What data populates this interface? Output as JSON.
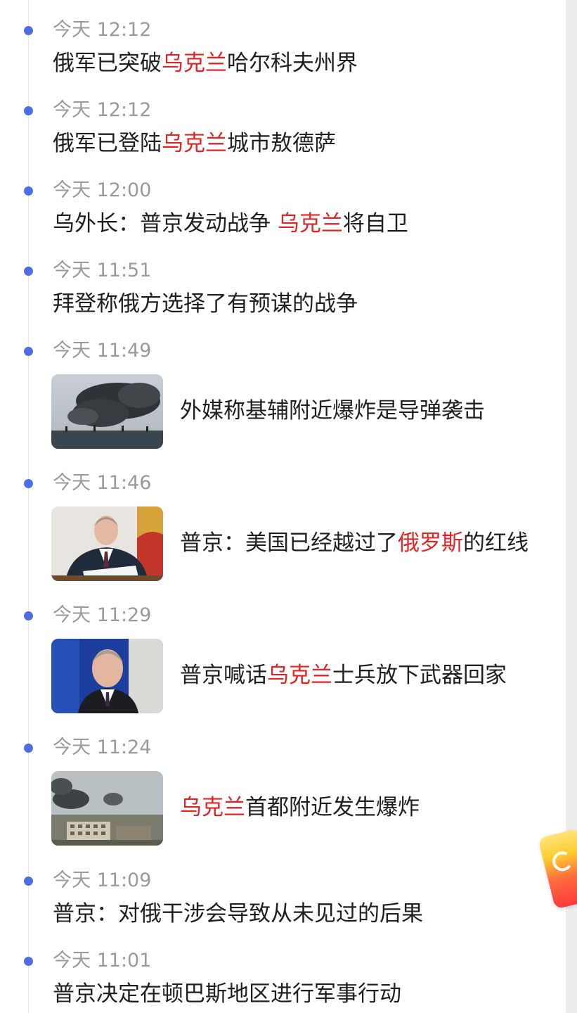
{
  "colors": {
    "accent_dot": "#4f6ee0",
    "highlight": "#e22424",
    "time": "#9a9a9a",
    "text": "#1f1f1f"
  },
  "feed": [
    {
      "time": "今天 12:12",
      "parts": [
        "俄军已突破",
        "乌克兰",
        "哈尔科夫州界"
      ]
    },
    {
      "time": "今天 12:12",
      "parts": [
        "俄军已登陆",
        "乌克兰",
        "城市敖德萨"
      ]
    },
    {
      "time": "今天 12:00",
      "parts": [
        "乌外长：普京发动战争 ",
        "乌克兰",
        "将自卫"
      ]
    },
    {
      "time": "今天 11:51",
      "parts": [
        "拜登称俄方选择了有预谋的战争",
        "",
        ""
      ]
    },
    {
      "time": "今天 11:49",
      "parts": [
        "外媒称基辅附近爆炸是导弹袭击",
        "",
        ""
      ],
      "image": "smoke-plumes-photo"
    },
    {
      "time": "今天 11:46",
      "parts": [
        "普京：美国已经越过了",
        "俄罗斯",
        "的红线"
      ],
      "image": "putin-at-desk-photo"
    },
    {
      "time": "今天 11:29",
      "parts": [
        "普京喊话",
        "乌克兰",
        "士兵放下武器回家"
      ],
      "image": "putin-portrait-photo"
    },
    {
      "time": "今天 11:24",
      "parts": [
        "",
        "乌克兰",
        "首都附近发生爆炸"
      ],
      "image": "city-explosion-photo"
    },
    {
      "time": "今天 11:09",
      "parts": [
        "普京：对俄干涉会导致从未见过的后果",
        "",
        ""
      ]
    },
    {
      "time": "今天 11:01",
      "parts": [
        "普京决定在顿巴斯地区进行军事行动",
        "",
        ""
      ]
    }
  ],
  "floating_widget": {
    "icon": "red-packet-icon"
  }
}
